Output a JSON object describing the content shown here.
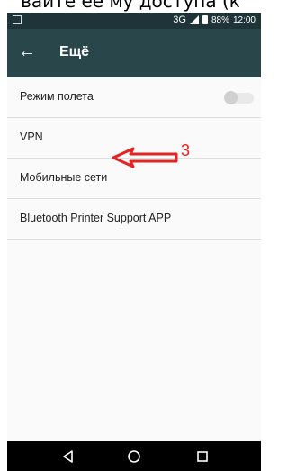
{
  "caption": "вайте ее му доступа (к",
  "status_bar": {
    "network": "3G",
    "battery": "88%",
    "time": "12:00"
  },
  "app_bar": {
    "title": "Ещё",
    "back_icon": "arrow-left-icon"
  },
  "settings": [
    {
      "label": "Режим полета"
    },
    {
      "label": "VPN"
    },
    {
      "label": "Мобильные сети"
    },
    {
      "label": "Bluetooth Printer Support APP"
    }
  ],
  "annotation": {
    "number": "3",
    "color": "#e32424"
  },
  "nav": [
    "back-icon",
    "home-icon",
    "recents-icon"
  ]
}
